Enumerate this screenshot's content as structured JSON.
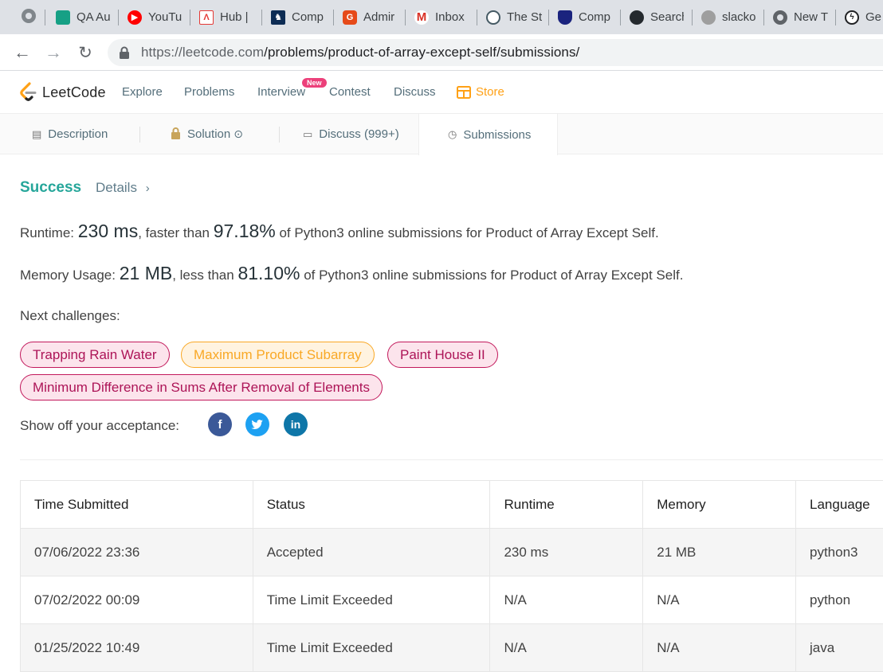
{
  "browser": {
    "tabs": [
      {
        "title": "QA Au",
        "icon": "qa-icon",
        "color": "#16a085"
      },
      {
        "title": "YouTu",
        "icon": "youtube-icon",
        "color": "#ff0000"
      },
      {
        "title": "Hub |",
        "icon": "adobe-icon",
        "color": "#e53935"
      },
      {
        "title": "Comp",
        "icon": "comp-icon",
        "color": "#0d2c54"
      },
      {
        "title": "Admir",
        "icon": "g-icon",
        "color": "#e64a19"
      },
      {
        "title": "Inbox",
        "icon": "gmail-icon",
        "color": "#d93025"
      },
      {
        "title": "The St",
        "icon": "panda-icon",
        "color": "#455a64"
      },
      {
        "title": "Comp",
        "icon": "shield-icon",
        "color": "#1a237e"
      },
      {
        "title": "Search",
        "icon": "github-icon",
        "color": "#24292e"
      },
      {
        "title": "slacko",
        "icon": "globe-icon",
        "color": "#9e9e9e"
      },
      {
        "title": "New T",
        "icon": "chrome-icon",
        "color": "#5f6368"
      },
      {
        "title": "Ge",
        "icon": "bolt-icon",
        "color": "#202124"
      }
    ],
    "url_domain": "https://leetcode.com",
    "url_path": "/problems/product-of-array-except-self/submissions/"
  },
  "nav": {
    "logo": "LeetCode",
    "items": [
      "Explore",
      "Problems",
      "Interview",
      "Contest",
      "Discuss",
      "Store"
    ],
    "new_badge": "New"
  },
  "problem_tabs": [
    "Description",
    "Solution",
    "Discuss (999+)",
    "Submissions"
  ],
  "result": {
    "status": "Success",
    "details": "Details",
    "runtime_label": "Runtime:",
    "runtime_value": "230 ms",
    "runtime_mid": ", faster than",
    "runtime_pct": "97.18%",
    "runtime_tail": "of Python3 online submissions for Product of Array Except Self.",
    "memory_label": "Memory Usage:",
    "memory_value": "21 MB",
    "memory_mid": ", less than",
    "memory_pct": "81.10%",
    "memory_tail": "of Python3 online submissions for Product of Array Except Self.",
    "next_label": "Next challenges:",
    "challenges": [
      {
        "name": "Trapping Rain Water",
        "level": "hard"
      },
      {
        "name": "Maximum Product Subarray",
        "level": "medium"
      },
      {
        "name": "Paint House II",
        "level": "hard"
      },
      {
        "name": "Minimum Difference in Sums After Removal of Elements",
        "level": "hard"
      }
    ],
    "share_label": "Show off your acceptance:"
  },
  "table": {
    "headers": [
      "Time Submitted",
      "Status",
      "Runtime",
      "Memory",
      "Language"
    ],
    "rows": [
      {
        "time": "07/06/2022 23:36",
        "status": "Accepted",
        "runtime": "230 ms",
        "memory": "21 MB",
        "language": "python3"
      },
      {
        "time": "07/02/2022 00:09",
        "status": "Time Limit Exceeded",
        "runtime": "N/A",
        "memory": "N/A",
        "language": "python"
      },
      {
        "time": "01/25/2022 10:49",
        "status": "Time Limit Exceeded",
        "runtime": "N/A",
        "memory": "N/A",
        "language": "java"
      }
    ]
  }
}
